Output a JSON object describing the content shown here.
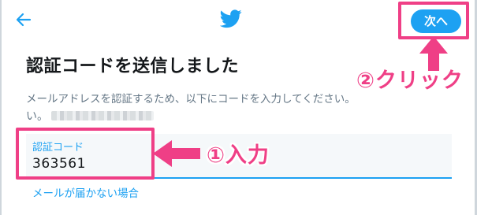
{
  "header": {
    "back_icon": "arrow-left-icon",
    "logo_icon": "twitter-bird-icon",
    "next_label": "次へ",
    "accent_color": "#1da1f2"
  },
  "main": {
    "title": "認証コードを送信しました",
    "description": "メールアドレスを認証するため、以下にコードを入力してください。",
    "email_prefix": "い。",
    "code_field": {
      "label": "認証コード",
      "value": "363561"
    },
    "resend_link": "メールが届かない場合"
  },
  "annotations": {
    "color": "#ef3f86",
    "click_text": "②クリック",
    "input_text": "①入力"
  }
}
